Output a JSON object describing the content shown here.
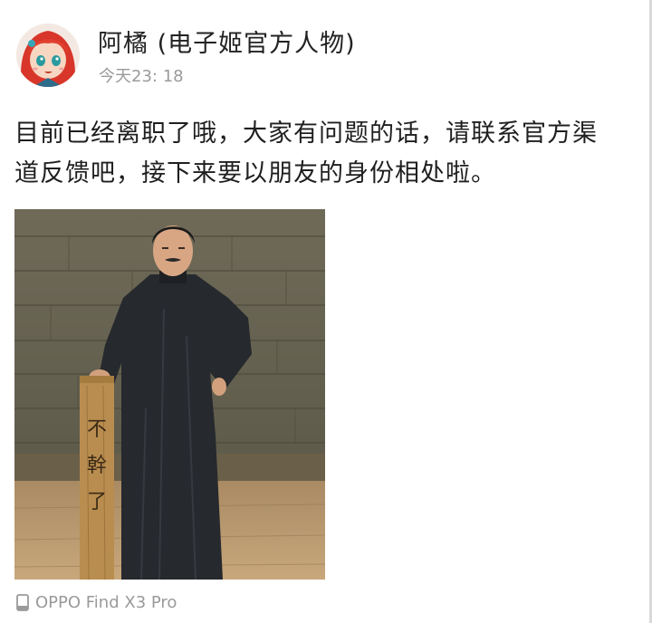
{
  "post": {
    "author": "阿橘 (电子姬官方人物)",
    "time": "今天23: 18",
    "body_line_1": "目前已经离职了哦，大家有问题的话，请联系官方渠",
    "body_line_2": "道反馈吧，接下来要以朋友的身份相处啦。",
    "image": {
      "sign_text": "不幹了"
    },
    "device": {
      "icon": "phone-icon",
      "label": "OPPO Find X3 Pro"
    }
  },
  "colors": {
    "text_primary": "#1f1f1f",
    "text_secondary": "#9a9a9a",
    "background": "#ffffff"
  }
}
